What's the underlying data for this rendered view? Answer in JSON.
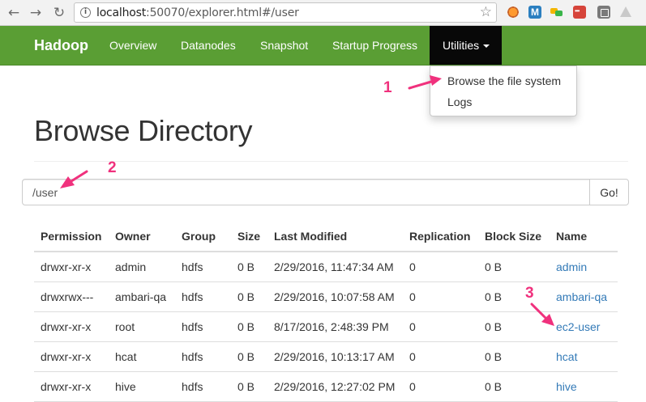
{
  "browser": {
    "url_host": "localhost",
    "url_rest": ":50070/explorer.html#/user"
  },
  "navbar": {
    "brand": "Hadoop",
    "items": [
      "Overview",
      "Datanodes",
      "Snapshot",
      "Startup Progress"
    ],
    "utilities_label": "Utilities",
    "accent_color": "#5a9e34"
  },
  "dropdown": {
    "items": [
      "Browse the file system",
      "Logs"
    ]
  },
  "page": {
    "title": "Browse Directory"
  },
  "path_form": {
    "value": "/user",
    "go_label": "Go!"
  },
  "table": {
    "headers": [
      "Permission",
      "Owner",
      "Group",
      "Size",
      "Last Modified",
      "Replication",
      "Block Size",
      "Name"
    ],
    "rows": [
      [
        "drwxr-xr-x",
        "admin",
        "hdfs",
        "0 B",
        "2/29/2016, 11:47:34 AM",
        "0",
        "0 B",
        "admin"
      ],
      [
        "drwxrwx---",
        "ambari-qa",
        "hdfs",
        "0 B",
        "2/29/2016, 10:07:58 AM",
        "0",
        "0 B",
        "ambari-qa"
      ],
      [
        "drwxr-xr-x",
        "root",
        "hdfs",
        "0 B",
        "8/17/2016, 2:48:39 PM",
        "0",
        "0 B",
        "ec2-user"
      ],
      [
        "drwxr-xr-x",
        "hcat",
        "hdfs",
        "0 B",
        "2/29/2016, 10:13:17 AM",
        "0",
        "0 B",
        "hcat"
      ],
      [
        "drwxr-xr-x",
        "hive",
        "hdfs",
        "0 B",
        "2/29/2016, 12:27:02 PM",
        "0",
        "0 B",
        "hive"
      ]
    ]
  },
  "annotations": [
    "1",
    "2",
    "3"
  ],
  "annotation_color": "#f0317d"
}
